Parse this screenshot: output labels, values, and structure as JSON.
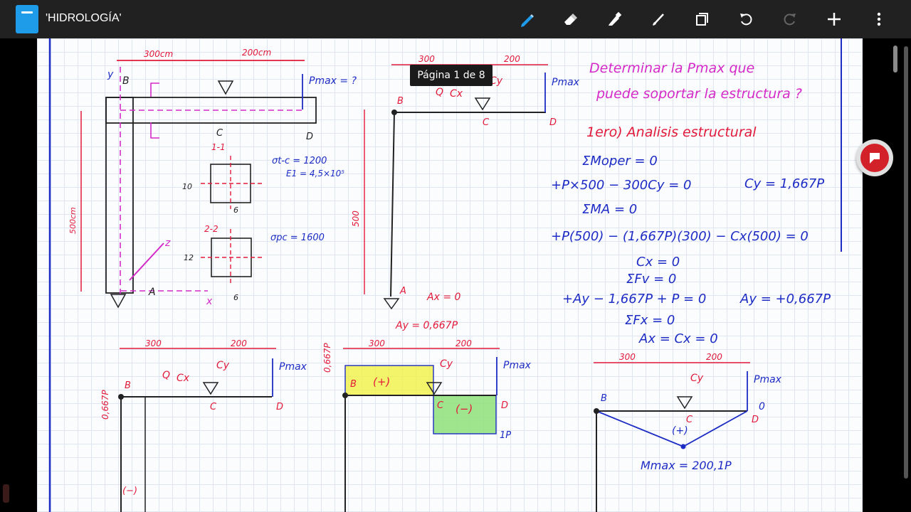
{
  "app": {
    "title": "'HIDROLOGÍA'"
  },
  "toolbar": {
    "tools": [
      {
        "name": "pen",
        "active": true
      },
      {
        "name": "eraser"
      },
      {
        "name": "highlighter"
      },
      {
        "name": "line"
      },
      {
        "name": "pages"
      },
      {
        "name": "undo"
      },
      {
        "name": "redo",
        "disabled": true
      },
      {
        "name": "add"
      },
      {
        "name": "more"
      }
    ]
  },
  "page_indicator": "Página 1 de 8",
  "notes": {
    "dim_300cm": "300cm",
    "dim_200cm": "200cm",
    "dim_500cm": "500cm",
    "label_B": "B",
    "label_C": "C",
    "label_D": "D",
    "label_A": "A",
    "label_y": "y",
    "label_z": "z",
    "label_x": "x",
    "pmax_q": "Pmax = ?",
    "pmax": "Pmax",
    "sec11": "1-1",
    "sec22": "2-2",
    "sigma_tc": "σt-c = 1200",
    "e1": "E1 = 4,5×10⁵",
    "sigma_pc": "σpc = 1600",
    "dim10": "10",
    "dim12": "12",
    "dim6": "6",
    "dim300": "300",
    "dim200": "200",
    "dim500": "500",
    "cy": "Cy",
    "cx": "Cx",
    "ax": "Ax = 0",
    "ay": "Ay = 0,667P",
    "q": "Q",
    "plus": "(+)",
    "minus": "(−)",
    "one_p": "1P",
    "p0667": "0,667P",
    "mmax": "Mmax = 200,1P",
    "heading1": "Determinar la Pmax que",
    "heading2": "puede soportar la estructura ?",
    "analysis": "1ero) Analisis estructural",
    "eq1": "ΣMoper = 0",
    "eq2": "+P×500 − 300Cy = 0",
    "eq2b": "Cy = 1,667P",
    "eq3": "ΣMA = 0",
    "eq4": "+P(500) − (1,667P)(300) − Cx(500) = 0",
    "eq5": "Cx = 0",
    "eq6": "ΣFv = 0",
    "eq7": "+Ay − 1,667P + P = 0",
    "eq7b": "Ay = +0,667P",
    "eq8": "ΣFx = 0",
    "eq9": "Ax = Cx = 0",
    "zero": "0"
  },
  "colors": {
    "ink_blue": "#1d2cc4",
    "ink_red": "#e21a3a",
    "ink_black": "#222222",
    "ink_magenta": "#d42ac8",
    "highlight_yellow": "#f2f23a",
    "highlight_green": "#8ee07a"
  }
}
